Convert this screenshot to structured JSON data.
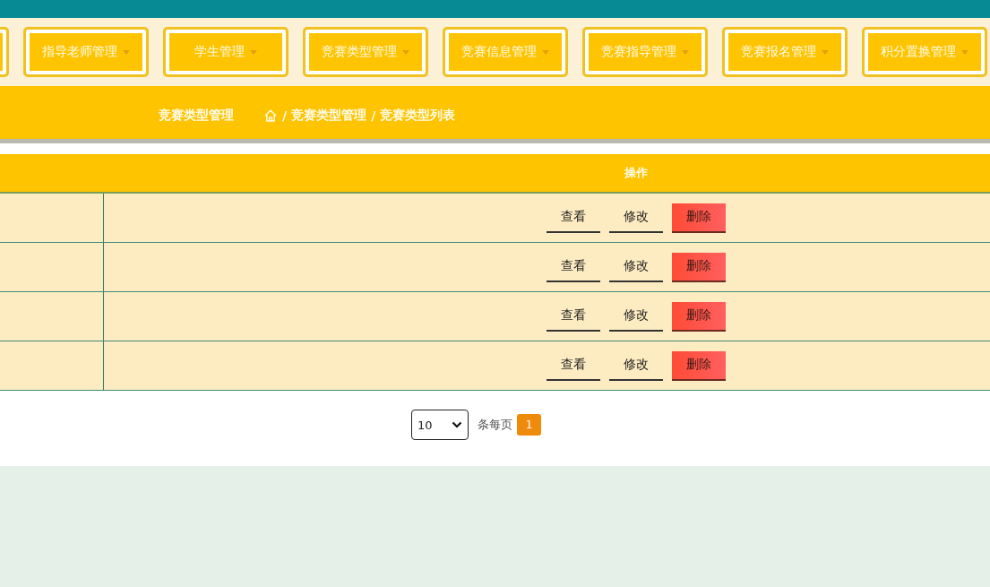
{
  "nav": {
    "cut_item_at_left": true,
    "items": [
      {
        "label": "指导老师管理"
      },
      {
        "label": "学生管理"
      },
      {
        "label": "竞赛类型管理"
      },
      {
        "label": "竞赛信息管理"
      },
      {
        "label": "竞赛指导管理"
      },
      {
        "label": "竞赛报名管理"
      },
      {
        "label": "积分置换管理"
      }
    ]
  },
  "breadcrumb": {
    "title": "竞赛类型管理",
    "crumbs": [
      {
        "separator": "/",
        "label": "竞赛类型管理"
      },
      {
        "separator": "/",
        "label": "竞赛类型列表"
      }
    ]
  },
  "table": {
    "action_header": "操作",
    "rows": [
      {
        "actions": [
          {
            "label": "查看",
            "kind": "view"
          },
          {
            "label": "修改",
            "kind": "edit"
          },
          {
            "label": "删除",
            "kind": "delete"
          }
        ]
      },
      {
        "actions": [
          {
            "label": "查看",
            "kind": "view"
          },
          {
            "label": "修改",
            "kind": "edit"
          },
          {
            "label": "删除",
            "kind": "delete"
          }
        ]
      },
      {
        "actions": [
          {
            "label": "查看",
            "kind": "view"
          },
          {
            "label": "修改",
            "kind": "edit"
          },
          {
            "label": "删除",
            "kind": "delete"
          }
        ]
      },
      {
        "actions": [
          {
            "label": "查看",
            "kind": "view"
          },
          {
            "label": "修改",
            "kind": "edit"
          },
          {
            "label": "删除",
            "kind": "delete"
          }
        ]
      }
    ]
  },
  "pagination": {
    "page_size": "10",
    "per_page_label": "条每页",
    "pages": [
      {
        "label": "1",
        "selected": true
      }
    ]
  }
}
